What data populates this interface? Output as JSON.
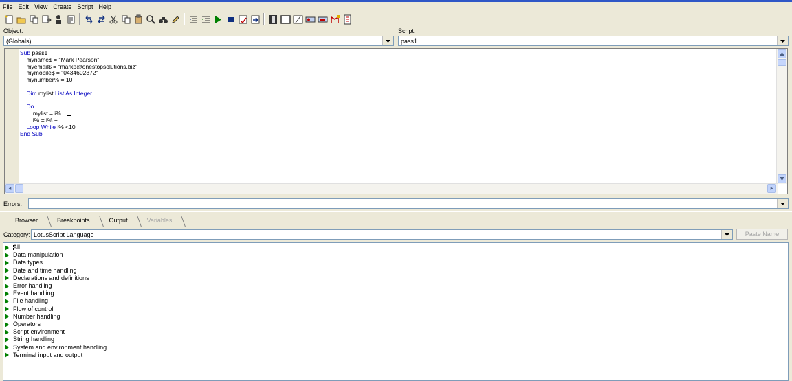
{
  "menu": [
    {
      "u": "F",
      "rest": "ile"
    },
    {
      "u": "E",
      "rest": "dit"
    },
    {
      "u": "V",
      "rest": "iew"
    },
    {
      "u": "C",
      "rest": "reate"
    },
    {
      "u": "S",
      "rest": "cript"
    },
    {
      "u": "H",
      "rest": "elp"
    }
  ],
  "object": {
    "label": "Object:",
    "value": "(Globals)"
  },
  "script": {
    "label": "Script:",
    "value": "pass1"
  },
  "code_lines": [
    {
      "segments": [
        {
          "t": "Sub ",
          "kw": true
        },
        {
          "t": "pass1",
          "kw": false
        }
      ]
    },
    {
      "segments": [
        {
          "t": "    myname$ = \"Mark Pearson\"",
          "kw": false
        }
      ]
    },
    {
      "segments": [
        {
          "t": "    myemail$ = \"markp@onestopsolutions.biz\"",
          "kw": false
        }
      ]
    },
    {
      "segments": [
        {
          "t": "    mymobile$ = \"0434602372\"",
          "kw": false
        }
      ]
    },
    {
      "segments": [
        {
          "t": "    mynumber% = 10",
          "kw": false
        }
      ]
    },
    {
      "segments": []
    },
    {
      "segments": [
        {
          "t": "    ",
          "kw": false
        },
        {
          "t": "Dim ",
          "kw": true
        },
        {
          "t": "mylist ",
          "kw": false
        },
        {
          "t": "List As Integer",
          "kw": true
        }
      ]
    },
    {
      "segments": []
    },
    {
      "segments": [
        {
          "t": "    ",
          "kw": false
        },
        {
          "t": "Do",
          "kw": true
        }
      ]
    },
    {
      "segments": [
        {
          "t": "        mylist = i%",
          "kw": false
        }
      ]
    },
    {
      "segments": [
        {
          "t": "        i% = i% +",
          "kw": false
        }
      ]
    },
    {
      "segments": [
        {
          "t": "    ",
          "kw": false
        },
        {
          "t": "Loop While ",
          "kw": true
        },
        {
          "t": "i% <10",
          "kw": false
        }
      ]
    },
    {
      "segments": [
        {
          "t": "End Sub",
          "kw": true
        }
      ]
    }
  ],
  "errors": {
    "label": "Errors:",
    "value": ""
  },
  "tabs": [
    {
      "label": "Browser",
      "disabled": false
    },
    {
      "label": "Breakpoints",
      "disabled": false
    },
    {
      "label": "Output",
      "disabled": false
    },
    {
      "label": "Variables",
      "disabled": true
    }
  ],
  "category": {
    "label": "Category:",
    "value": "LotusScript Language"
  },
  "paste_button": "Paste Name",
  "browser_items": [
    "All",
    "Data manipulation",
    "Data types",
    "Date and time handling",
    "Declarations and definitions",
    "Error handling",
    "Event handling",
    "File handling",
    "Flow of control",
    "Number handling",
    "Operators",
    "Script environment",
    "String handling",
    "System and environment handling",
    "Terminal input and output"
  ],
  "colors": {
    "keyword": "#0000c0",
    "tree_triangle": "#008000",
    "title_accent": "#2f57c7"
  }
}
